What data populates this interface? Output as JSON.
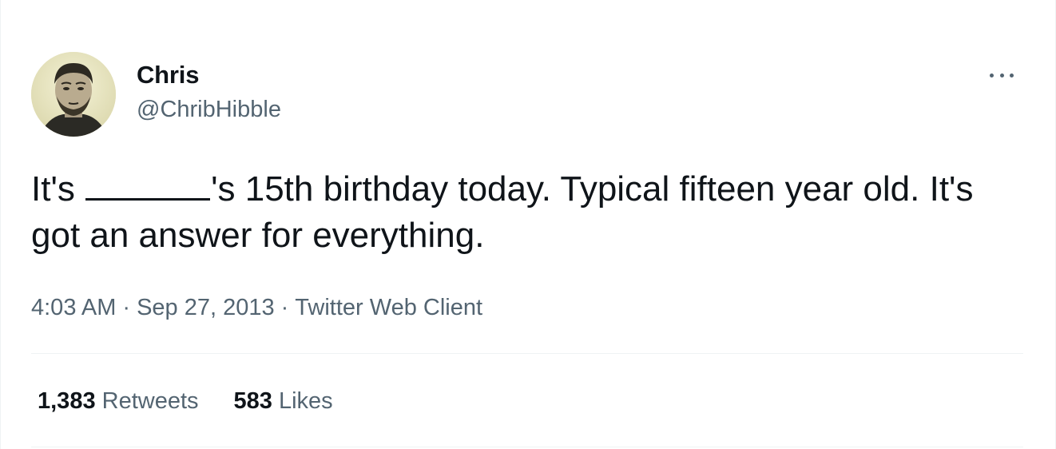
{
  "author": {
    "display_name": "Chris",
    "handle": "@ChribHibble"
  },
  "tweet": {
    "text_part1": "It's",
    "text_part2": "'s 15th birthday today. Typical fifteen year old. It's got an answer for everything."
  },
  "meta": {
    "time": "4:03 AM",
    "separator": "·",
    "date": "Sep 27, 2013",
    "client": "Twitter Web Client"
  },
  "stats": {
    "retweets_count": "1,383",
    "retweets_label": "Retweets",
    "likes_count": "583",
    "likes_label": "Likes"
  },
  "colors": {
    "text_primary": "#0f1419",
    "text_secondary": "#536471",
    "divider": "#eff3f4"
  },
  "icons": {
    "more": "more-horizontal-icon"
  }
}
